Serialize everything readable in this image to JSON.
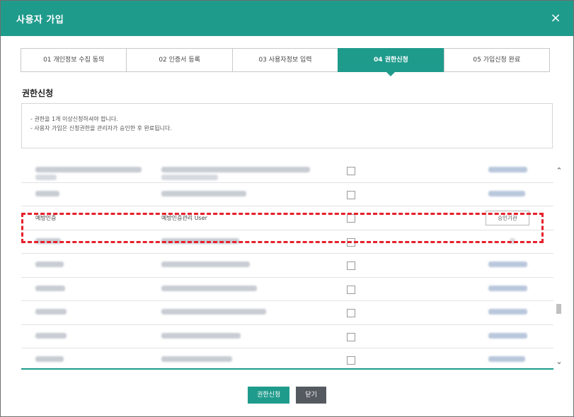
{
  "dialog": {
    "title": "사용자 가입",
    "close_symbol": "×"
  },
  "steps": [
    {
      "label": "01 개인정보 수집 동의",
      "active": false
    },
    {
      "label": "02 인증서 등록",
      "active": false
    },
    {
      "label": "03 사용자정보 입력",
      "active": false
    },
    {
      "label": "04 권한신청",
      "active": true
    },
    {
      "label": "05 가입신청 완료",
      "active": false
    }
  ],
  "section_title": "권한신청",
  "notice": [
    "- 권한을 1개 이상신청하셔야 합니다.",
    "- 사용자 가입은 신청권한을 관리자가 승인한 후 완료됩니다."
  ],
  "highlighted_row": {
    "system": "예방인증",
    "role": "예방인증관리 User",
    "approver_button": "승인기관"
  },
  "footer": {
    "apply_label": "권한신청",
    "close_label": "닫기"
  },
  "colors": {
    "accent": "#1f9b8c",
    "highlight": "#e5202a"
  },
  "icons": {
    "close": "close-icon",
    "scroll_up": "chevron-up-icon",
    "scroll_down": "chevron-down-icon"
  }
}
